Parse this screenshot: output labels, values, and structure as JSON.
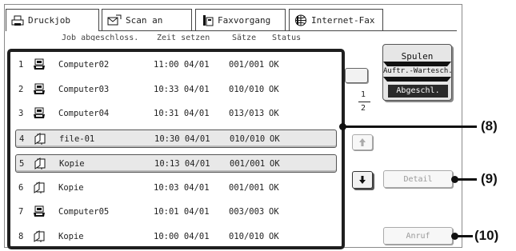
{
  "tabs": [
    {
      "label": "Druckjob",
      "icon": "printer-icon",
      "active": true
    },
    {
      "label": "Scan an",
      "icon": "scan-to-icon",
      "active": false
    },
    {
      "label": "Faxvorgang",
      "icon": "fax-icon",
      "active": false
    },
    {
      "label": "Internet-Fax",
      "icon": "internet-fax-icon",
      "active": false
    }
  ],
  "columns": [
    "Job abgeschloss.",
    "Zeit setzen",
    "Sätze",
    "Status"
  ],
  "jobs": [
    {
      "num": "1",
      "icon": "computer-job-icon",
      "name": "Computer02",
      "time": "11:00 04/01",
      "sets": "001/001",
      "status": "OK",
      "selected": false
    },
    {
      "num": "2",
      "icon": "computer-job-icon",
      "name": "Computer03",
      "time": "10:33 04/01",
      "sets": "010/010",
      "status": "OK",
      "selected": false
    },
    {
      "num": "3",
      "icon": "computer-job-icon",
      "name": "Computer04",
      "time": "10:31 04/01",
      "sets": "013/013",
      "status": "OK",
      "selected": false
    },
    {
      "num": "4",
      "icon": "copy-job-icon",
      "name": "file-01",
      "time": "10:30 04/01",
      "sets": "010/010",
      "status": "OK",
      "selected": true
    },
    {
      "num": "5",
      "icon": "copy-job-icon",
      "name": "Kopie",
      "time": "10:13 04/01",
      "sets": "001/001",
      "status": "OK",
      "selected": true
    },
    {
      "num": "6",
      "icon": "copy-job-icon",
      "name": "Kopie",
      "time": "10:03 04/01",
      "sets": "001/001",
      "status": "OK",
      "selected": false
    },
    {
      "num": "7",
      "icon": "computer-job-icon",
      "name": "Computer05",
      "time": "10:01 04/01",
      "sets": "003/003",
      "status": "OK",
      "selected": false
    },
    {
      "num": "8",
      "icon": "copy-job-icon",
      "name": "Kopie",
      "time": "10:00 04/01",
      "sets": "010/010",
      "status": "OK",
      "selected": false
    }
  ],
  "pager": {
    "current": "1",
    "total": "2"
  },
  "spool_button": {
    "spool": "Spulen",
    "queue": "Auftr.-Wartesch.",
    "completed": "Abgeschl."
  },
  "buttons": {
    "detail": "Detail",
    "recall": "Anruf"
  },
  "callouts": {
    "list": "(8)",
    "detail": "(9)",
    "recall": "(10)"
  }
}
